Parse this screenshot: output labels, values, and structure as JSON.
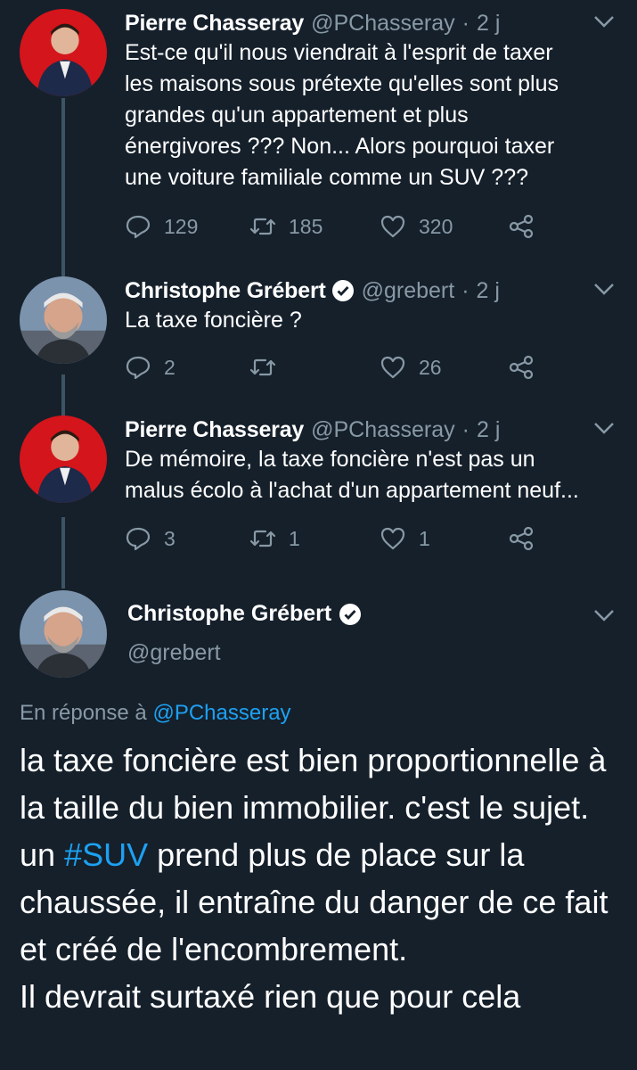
{
  "tweets": [
    {
      "name": "Pierre Chasseray",
      "handle": "@PChasseray",
      "sep": "·",
      "time": "2 j",
      "text": "Est-ce qu'il nous viendrait à l'esprit de taxer\nles maisons sous prétexte qu'elles sont plus\ngrandes qu'un appartement et plus\nénergivores ??? Non... Alors pourquoi taxer\nune voiture familiale comme un SUV ???",
      "replies": "129",
      "retweets": "185",
      "likes": "320"
    },
    {
      "name": "Christophe Grébert",
      "handle": "@grebert",
      "sep": "·",
      "time": "2 j",
      "text": "La taxe foncière ?",
      "replies": "2",
      "retweets": "",
      "likes": "26"
    },
    {
      "name": "Pierre Chasseray",
      "handle": "@PChasseray",
      "sep": "·",
      "time": "2 j",
      "text": "De mémoire, la taxe foncière n'est pas un\nmalus écolo à l'achat d'un appartement neuf...",
      "replies": "3",
      "retweets": "1",
      "likes": "1"
    }
  ],
  "main": {
    "name": "Christophe Grébert",
    "handle": "@grebert",
    "reply_prefix": "En réponse à",
    "reply_to": "@PChasseray",
    "text_1": "la taxe foncière est bien proportionnelle à la taille du bien immobilier. c'est le sujet.",
    "text_2a": "un",
    "hashtag": "#SUV",
    "text_2b": "prend plus de place sur la chaussée, il entraîne du danger de ce fait et créé de l'encombrement.",
    "text_3": "Il devrait surtaxé rien que pour cela"
  },
  "colors": {
    "background": "#15202b",
    "secondary_text": "#8899a6",
    "link": "#1da1f2",
    "verified": "#ffffff"
  },
  "icons": [
    "reply-icon",
    "retweet-icon",
    "like-icon",
    "share-icon",
    "chevron-down-icon",
    "verified-badge-icon"
  ]
}
